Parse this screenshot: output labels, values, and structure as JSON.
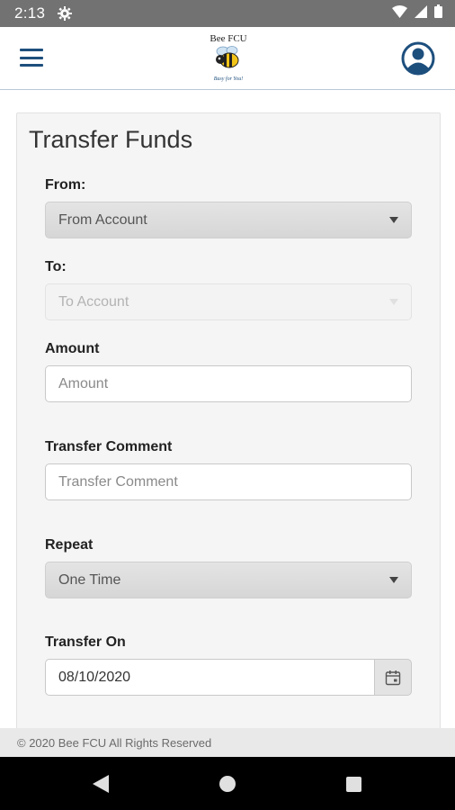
{
  "status_bar": {
    "time": "2:13"
  },
  "header": {
    "logo_text": "Bee FCU",
    "logo_tagline": "Busy for You!"
  },
  "form": {
    "title": "Transfer Funds",
    "from_label": "From:",
    "from_value": "From Account",
    "to_label": "To:",
    "to_value": "To Account",
    "amount_label": "Amount",
    "amount_placeholder": "Amount",
    "comment_label": "Transfer Comment",
    "comment_placeholder": "Transfer Comment",
    "repeat_label": "Repeat",
    "repeat_value": "One Time",
    "transfer_on_label": "Transfer On",
    "transfer_on_value": "08/10/2020"
  },
  "footer": {
    "text": "© 2020 Bee FCU All Rights Reserved"
  },
  "colors": {
    "brand": "#1d4f7d",
    "status_bar": "#727272",
    "nav_bar": "#000000"
  }
}
